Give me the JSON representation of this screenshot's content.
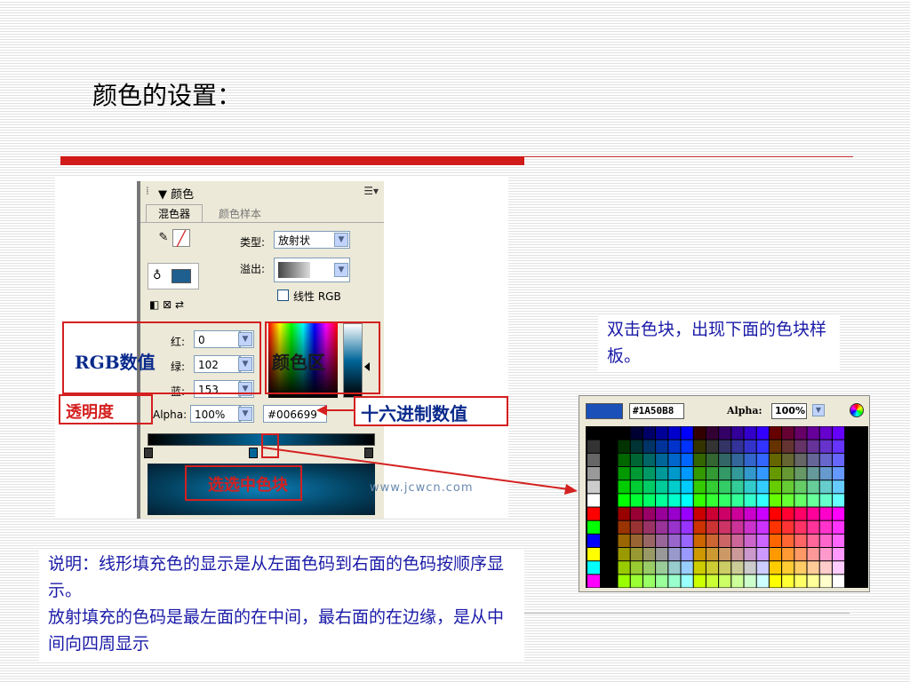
{
  "slide": {
    "title": "颜色的设置："
  },
  "panel": {
    "header_title": "▼ 颜色",
    "tab_mixer": "混色器",
    "tab_swatches": "颜色样本",
    "type_label": "类型:",
    "type_value": "放射状",
    "overflow_label": "溢出:",
    "linear_rgb_label": "线性 RGB",
    "red_label": "红:",
    "red_value": "0",
    "green_label": "绿:",
    "green_value": "102",
    "blue_label": "蓝:",
    "blue_value": "153",
    "alpha_label": "Alpha:",
    "alpha_value": "100%",
    "hex_value": "#006699",
    "watermark": "www.jcwcn.com"
  },
  "callouts": {
    "rgb_values": "RGB数值",
    "color_area": "颜色区",
    "transparency": "透明度",
    "hex_values": "十六进制数值",
    "selected_swatch": "选选中色块"
  },
  "palette": {
    "hex_value": "#1A50B8",
    "alpha_label": "Alpha:",
    "alpha_value": "100%",
    "current_color": "#1a50b8"
  },
  "notes": {
    "top": "双击色块，出现下面的色块样板。",
    "bottom_line1": "说明：线形填充色的显示是从左面色码到右面的色码按顺序显示。",
    "bottom_line2": "放射填充的色码是最左面的在中间，最右面的在边缘，是从中间向四周显示"
  },
  "colors": {
    "accent_red": "#d42020",
    "note_blue": "#1a1aa8",
    "callout_blue": "#0a2a8c",
    "selected_color": "#006699"
  }
}
